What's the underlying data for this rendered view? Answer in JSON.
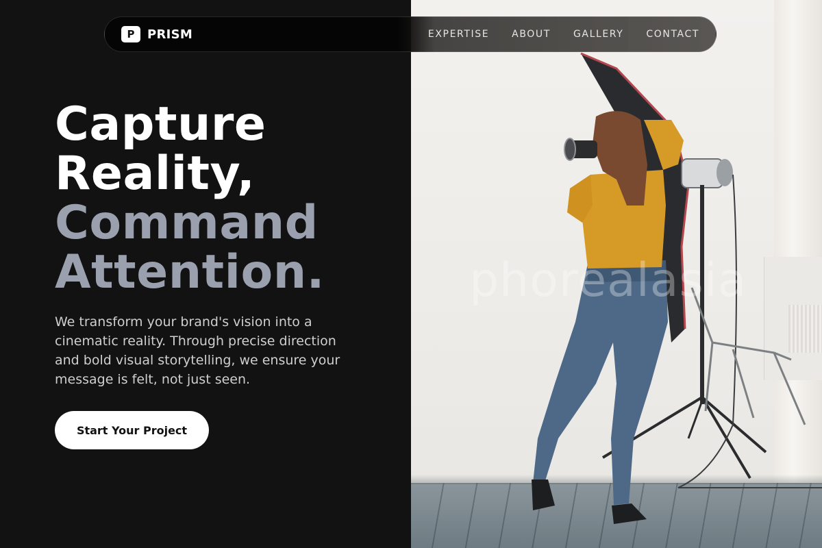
{
  "brand": {
    "logo_letter": "P",
    "name": "PRISM"
  },
  "nav": {
    "links": [
      {
        "label": "EXPERTISE"
      },
      {
        "label": "ABOUT"
      },
      {
        "label": "GALLERY"
      },
      {
        "label": "CONTACT"
      }
    ]
  },
  "hero": {
    "headline_lines": [
      "Capture",
      "Reality,",
      "Command",
      "Attention."
    ],
    "description": "We transform your brand's vision into a cinematic reality. Through precise direction and bold visual storytelling, we ensure your message is felt, not just seen.",
    "cta_label": "Start Your Project"
  },
  "photo": {
    "watermark": "phorealasia"
  },
  "colors": {
    "background": "#121212",
    "headline_primary": "#ffffff",
    "headline_secondary": "#9aa0ae",
    "button_bg": "#ffffff"
  }
}
